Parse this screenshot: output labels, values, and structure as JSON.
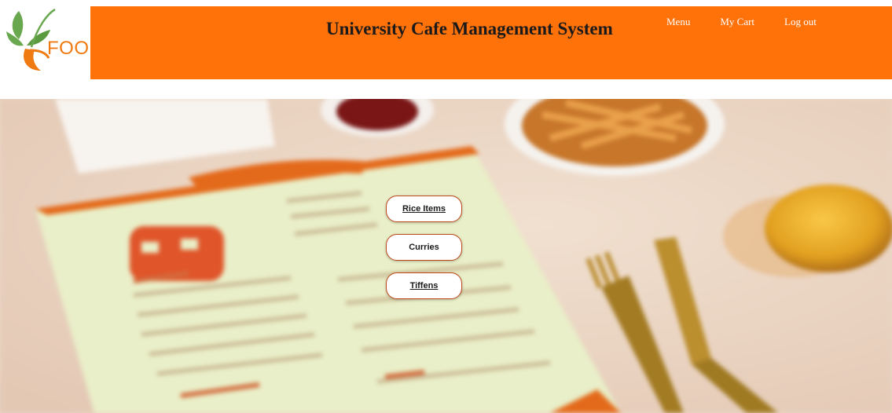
{
  "brand": {
    "logo_text": "FOOD",
    "logo_colors": {
      "leaf_orange": "#f07a12",
      "leaf_green": "#6aa84f"
    }
  },
  "header": {
    "title": "University Cafe Management System",
    "background": "#ff7109",
    "nav": [
      {
        "label": "Menu"
      },
      {
        "label": "My Cart"
      },
      {
        "label": "Log out"
      }
    ]
  },
  "hero": {
    "image": "blurred-food-menu-table-photo",
    "categories": [
      {
        "label": "Rice Items",
        "underlined": true
      },
      {
        "label": "Curries",
        "underlined": false
      },
      {
        "label": "Tiffens",
        "underlined": true
      }
    ]
  }
}
